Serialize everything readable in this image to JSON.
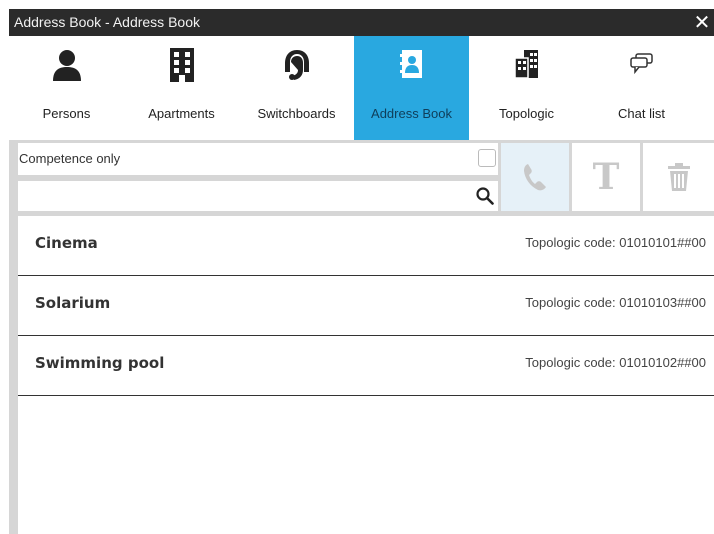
{
  "window": {
    "title": "Address Book - Address Book",
    "close_glyph": "✕"
  },
  "tabs": [
    {
      "label": "Persons",
      "icon": "person-icon"
    },
    {
      "label": "Apartments",
      "icon": "building-icon"
    },
    {
      "label": "Switchboards",
      "icon": "headset-icon"
    },
    {
      "label": "Address Book",
      "icon": "address-book-icon",
      "active": true
    },
    {
      "label": "Topologic",
      "icon": "buildings-icon"
    },
    {
      "label": "Chat list",
      "icon": "chat-icon"
    }
  ],
  "filter": {
    "competence_label": "Competence only",
    "competence_checked": false,
    "search_value": "",
    "search_placeholder": ""
  },
  "actions": {
    "call_icon": "phone-icon",
    "text_label": "T",
    "delete_icon": "trash-icon"
  },
  "entries": [
    {
      "name": "Cinema",
      "code": "Topologic code: 01010101##00"
    },
    {
      "name": "Solarium",
      "code": "Topologic code: 01010103##00"
    },
    {
      "name": "Swimming pool",
      "code": "Topologic code: 01010102##00"
    }
  ],
  "colors": {
    "titlebar": "#2b2b2b",
    "active_tab": "#29a8e0",
    "frame": "#d6d6d6",
    "disabled_icon": "#c8c8c8"
  }
}
